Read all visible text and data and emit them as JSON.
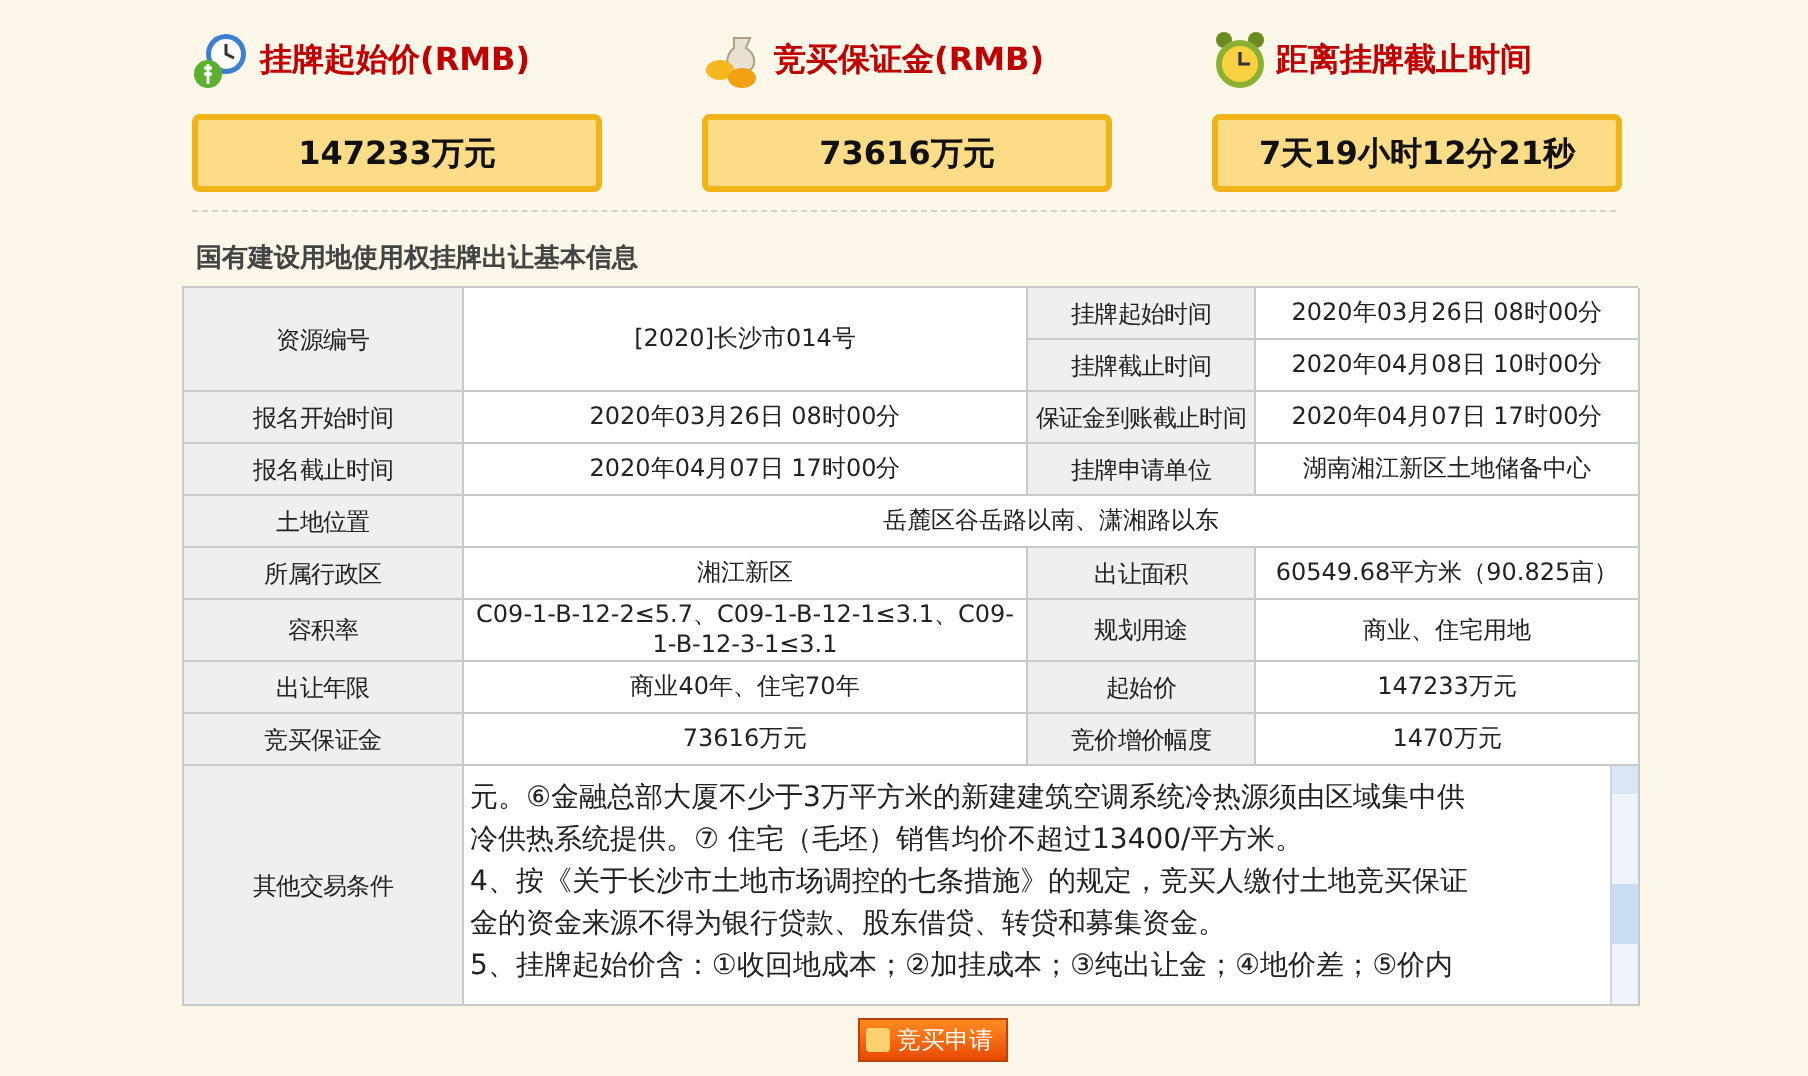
{
  "summary": [
    {
      "kind": "price",
      "title": "挂牌起始价(RMB)",
      "value": "147233万元"
    },
    {
      "kind": "deposit",
      "title": "竞买保证金(RMB)",
      "value": "73616万元"
    },
    {
      "kind": "countdown",
      "title": "距离挂牌截止时间",
      "value": "7天19小时12分21秒"
    }
  ],
  "section_title": "国有建设用地使用权挂牌出让基本信息",
  "fields": [
    {
      "kind": "tall",
      "label": "资源编号",
      "value": "[2020]长沙市014号"
    },
    {
      "kind": "normal",
      "label": "挂牌起始时间",
      "value": "2020年03月26日 08时00分"
    },
    {
      "kind": "normal",
      "label": "挂牌截止时间",
      "value": "2020年04月08日 10时00分"
    },
    {
      "kind": "normal",
      "label": "报名开始时间",
      "value": "2020年03月26日 08时00分"
    },
    {
      "kind": "normal",
      "label": "保证金到账截止时间",
      "value": "2020年04月07日 17时00分"
    },
    {
      "kind": "normal",
      "label": "报名截止时间",
      "value": "2020年04月07日 17时00分"
    },
    {
      "kind": "normal",
      "label": "挂牌申请单位",
      "value": "湖南湘江新区土地储备中心"
    },
    {
      "kind": "wide",
      "label": "土地位置",
      "value": "岳麓区谷岳路以南、潇湘路以东"
    },
    {
      "kind": "normal",
      "label": "所属行政区",
      "value": "湘江新区"
    },
    {
      "kind": "normal",
      "label": "出让面积",
      "value": "60549.68平方米（90.825亩）"
    },
    {
      "kind": "normal",
      "label": "容积率",
      "value": "C09-1-B-12-2≤5.7、C09-1-B-12-1≤3.1、C09-1-B-12-3-1≤3.1"
    },
    {
      "kind": "normal",
      "label": "规划用途",
      "value": "商业、住宅用地"
    },
    {
      "kind": "normal",
      "label": "出让年限",
      "value": "商业40年、住宅70年"
    },
    {
      "kind": "normal",
      "label": "起始价",
      "value": "147233万元"
    },
    {
      "kind": "normal",
      "label": "竞买保证金",
      "value": "73616万元"
    },
    {
      "kind": "normal",
      "label": "竞价增价幅度",
      "value": "1470万元"
    }
  ],
  "other_conditions": {
    "label": "其他交易条件",
    "lines": [
      "元。⑥金融总部大厦不少于3万平方米的新建建筑空调系统冷热源须由区域集中供",
      "冷供热系统提供。⑦ 住宅（毛坯）销售均价不超过13400/平方米。",
      "4、按《关于长沙市土地市场调控的七条措施》的规定，竞买人缴付土地竞买保证",
      "金的资金来源不得为银行贷款、股东借贷、转贷和募集资金。",
      "5、挂牌起始价含：①收回地成本；②加挂成本；③纯出让金；④地价差；⑤价内"
    ]
  },
  "apply_button": "竞买申请"
}
